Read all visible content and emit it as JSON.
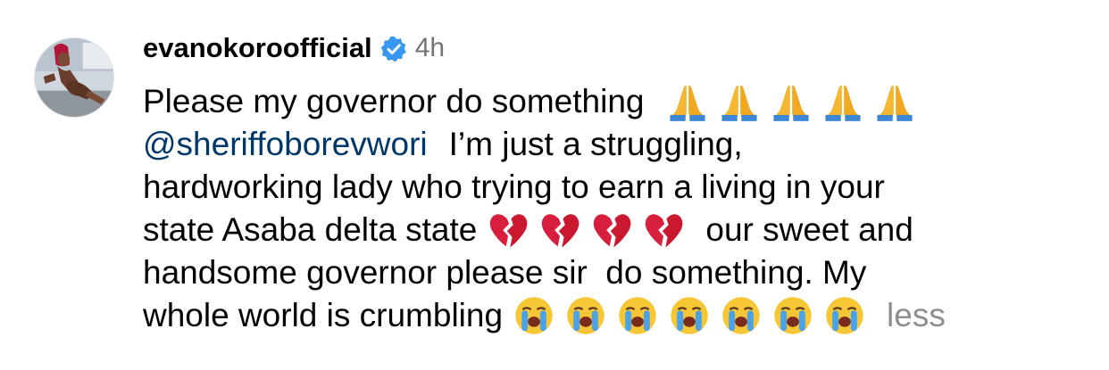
{
  "comment": {
    "avatar_icon": "profile-photo-avatar",
    "username": "evanokoroofficial",
    "verified_icon": "verified-badge-icon",
    "verified_color": "#3897f0",
    "timestamp": "4h",
    "lines": {
      "l1_text": "Please my governor do something",
      "l1_emoji": "folded-hands-emoji",
      "l1_emoji_count": 5,
      "l2_mention": "@sheriffoborevwori",
      "l2_text": "I’m just a struggling,",
      "l3_text": "hardworking lady who trying to earn a living in your",
      "l4_text_a": "state Asaba delta state",
      "l4_emoji": "broken-heart-emoji",
      "l4_emoji_count": 4,
      "l4_text_b": "our sweet and",
      "l5_text": "handsome governor please sir  do something. My",
      "l6_text": "whole world is crumbling",
      "l6_emoji": "loudly-crying-face-emoji",
      "l6_emoji_count": 7,
      "less_label": "less"
    },
    "colors": {
      "text": "#000000",
      "mention": "#00376b",
      "muted": "#737373",
      "less": "#8e8e8e"
    }
  }
}
